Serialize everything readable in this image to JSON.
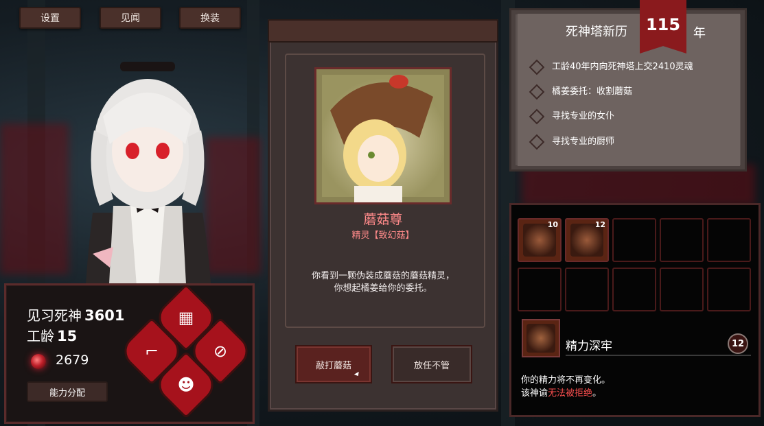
{
  "top_buttons": {
    "settings": "设置",
    "journal": "见闻",
    "outfit": "换装"
  },
  "player": {
    "rank": "见习死神",
    "id_number": "3601",
    "age_label": "工龄",
    "age_value": "15",
    "souls": "2679",
    "allot_label": "能力分配"
  },
  "event": {
    "title": "蘑菇尊",
    "subtitle": "精灵【致幻菇】",
    "description_line1": "你看到一颗伪装成蘑菇的蘑菇精灵，",
    "description_line2": "你想起橘姜给你的委托。",
    "choice_a": "敲打蘑菇",
    "choice_b": "放任不管"
  },
  "chronicle": {
    "title": "死神塔新历",
    "year": "115",
    "year_unit": "年",
    "tasks": [
      "工龄40年内向死神塔上交2410灵魂",
      "橘姜委托：收割蘑菇",
      "寻找专业的女仆",
      "寻找专业的厨师"
    ]
  },
  "inventory": {
    "slot_counts": [
      "10",
      "12"
    ],
    "selected_name": "精力深牢",
    "selected_timer": "12",
    "effect_line1": "你的精力将不再变化。",
    "effect_line2_prefix": "该神谕",
    "effect_line2_highlight": "无法被拒绝",
    "effect_line2_suffix": "。"
  },
  "colors": {
    "accent_red": "#a6121c",
    "title_pink": "#ff8a8a",
    "panel_brown": "#4a302a"
  },
  "icons": [
    "layers-icon",
    "scythe-icon",
    "forbid-icon",
    "demon-icon"
  ]
}
